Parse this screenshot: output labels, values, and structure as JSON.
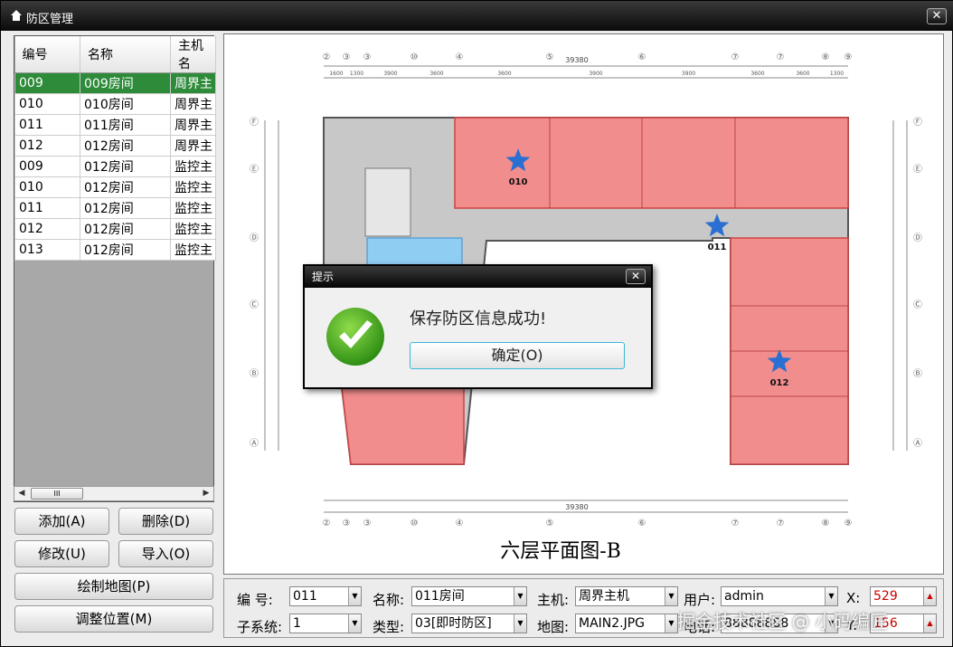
{
  "window": {
    "title": "防区管理"
  },
  "table": {
    "headers": [
      "编号",
      "名称",
      "主机名"
    ],
    "rows": [
      [
        "009",
        "009房间",
        "周界主"
      ],
      [
        "010",
        "010房间",
        "周界主"
      ],
      [
        "011",
        "011房间",
        "周界主"
      ],
      [
        "012",
        "012房间",
        "周界主"
      ],
      [
        "009",
        "012房间",
        "监控主"
      ],
      [
        "010",
        "012房间",
        "监控主"
      ],
      [
        "011",
        "012房间",
        "监控主"
      ],
      [
        "012",
        "012房间",
        "监控主"
      ],
      [
        "013",
        "012房间",
        "监控主"
      ]
    ],
    "selected_index": 0
  },
  "scroll": {
    "thumb_glyph": "III"
  },
  "buttons": {
    "add": "添加(A)",
    "delete": "删除(D)",
    "edit": "修改(U)",
    "import": "导入(O)",
    "draw_map": "绘制地图(P)",
    "adjust_position": "调整位置(M)"
  },
  "map": {
    "caption": "六层平面图-B",
    "markers": [
      "010",
      "011",
      "012"
    ],
    "total_dim": "39380",
    "axis_top": [
      "②",
      "③",
      "③",
      "⑩",
      "④",
      "⑤",
      "⑥",
      "⑦",
      "⑦",
      "⑧",
      "⑨"
    ],
    "axis_left": [
      "Ⓕ",
      "Ⓔ",
      "Ⓓ",
      "Ⓒ",
      "Ⓑ",
      "Ⓐ"
    ],
    "dims_top": [
      "1600",
      "1300",
      "3900",
      "3600",
      "3600",
      "3900",
      "3900",
      "3600",
      "3600",
      "1300"
    ]
  },
  "dialog": {
    "title": "提示",
    "message": "保存防区信息成功!",
    "ok": "确定(O)",
    "close": "✕"
  },
  "form": {
    "id_label": "编 号:",
    "id_value": "011",
    "name_label": "名称:",
    "name_value": "011房间",
    "host_label": "主机:",
    "host_value": "周界主机",
    "user_label": "用户:",
    "user_value": "admin",
    "x_label": "X:",
    "x_value": "529",
    "subsystem_label": "子系统:",
    "subsystem_value": "1",
    "type_label": "类型:",
    "type_value": "03[即时防区]",
    "map_label": "地图:",
    "map_value": "MAIN2.JPG",
    "phone_label": "电话:",
    "phone_value": "88888888",
    "y_label": "Y:",
    "y_value": "156"
  },
  "watermark": "掘金技术社区 @ 小码编匠",
  "colors": {
    "selected_row": "#2e8b3a",
    "zone_fill": "#f28d8d",
    "marker": "#2a6fd1",
    "ok_border": "#3bb7d8"
  }
}
